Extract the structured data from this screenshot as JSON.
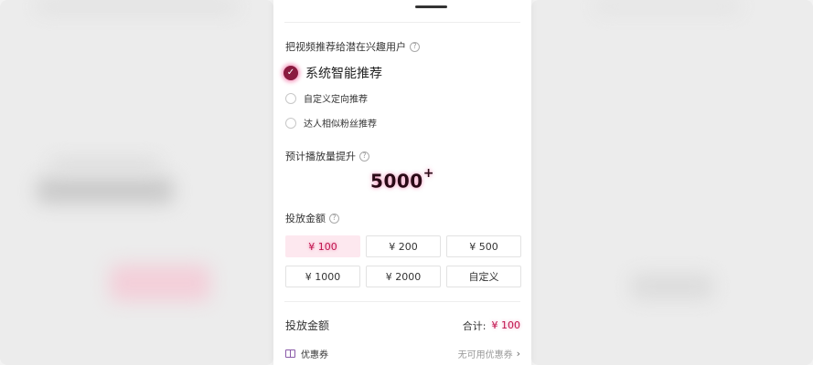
{
  "promote_target": {
    "title": "把视频推荐给潜在兴趣用户",
    "help_icon": "?",
    "options": [
      {
        "label": "系统智能推荐",
        "selected": true
      },
      {
        "label": "自定义定向推荐",
        "selected": false
      },
      {
        "label": "达人相似粉丝推荐",
        "selected": false
      }
    ]
  },
  "estimate": {
    "title": "预计播放量提升",
    "help_icon": "?",
    "value": "5000",
    "suffix": "+"
  },
  "amount": {
    "title": "投放金额",
    "help_icon": "?",
    "options": [
      "¥ 100",
      "¥ 200",
      "¥ 500",
      "¥ 1000",
      "¥ 2000",
      "自定义"
    ],
    "selected_index": 0
  },
  "summary": {
    "label": "投放金额",
    "total_label": "合计:",
    "total_value": "¥ 100"
  },
  "coupon": {
    "label": "优惠券",
    "status": "无可用优惠券",
    "chevron": "›"
  },
  "colors": {
    "accent": "#e82878",
    "selected_bg": "#fde8ef",
    "checked_radio": "#8a1a3f"
  }
}
